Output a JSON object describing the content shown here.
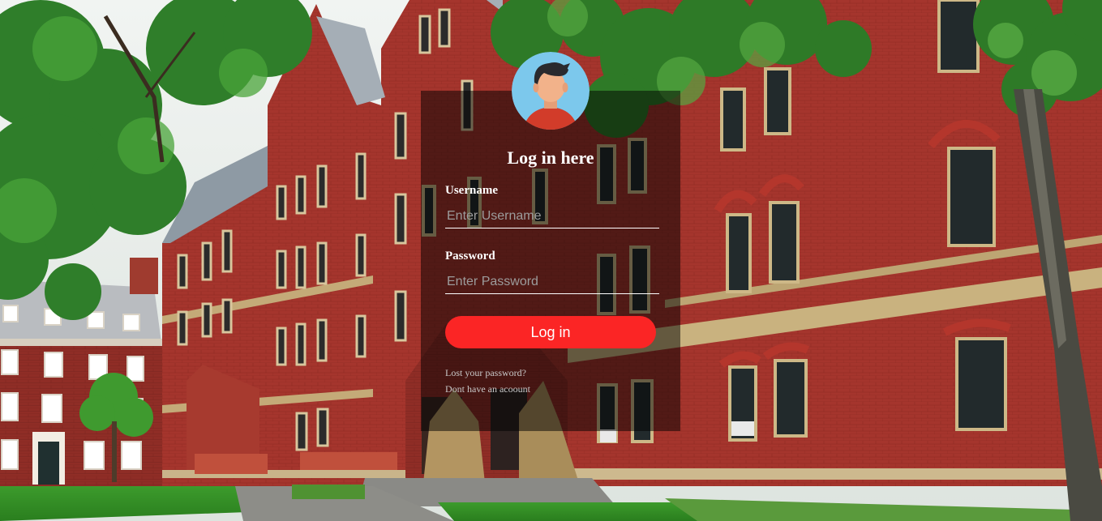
{
  "login": {
    "title": "Log in here",
    "username_label": "Username",
    "username_placeholder": "Enter Username",
    "username_value": "",
    "password_label": "Password",
    "password_placeholder": "Enter Password",
    "password_value": "",
    "submit_label": "Log in",
    "lost_password_link": "Lost your password?",
    "signup_link": "Dont have an acoount"
  },
  "colors": {
    "button": "#fb2525",
    "card_overlay": "rgba(0,0,0,0.5)",
    "avatar_bg": "#7cc8ec",
    "brick": "#a8332c"
  },
  "icons": {
    "avatar": "user-avatar-icon",
    "background": "campus-building-photo"
  }
}
